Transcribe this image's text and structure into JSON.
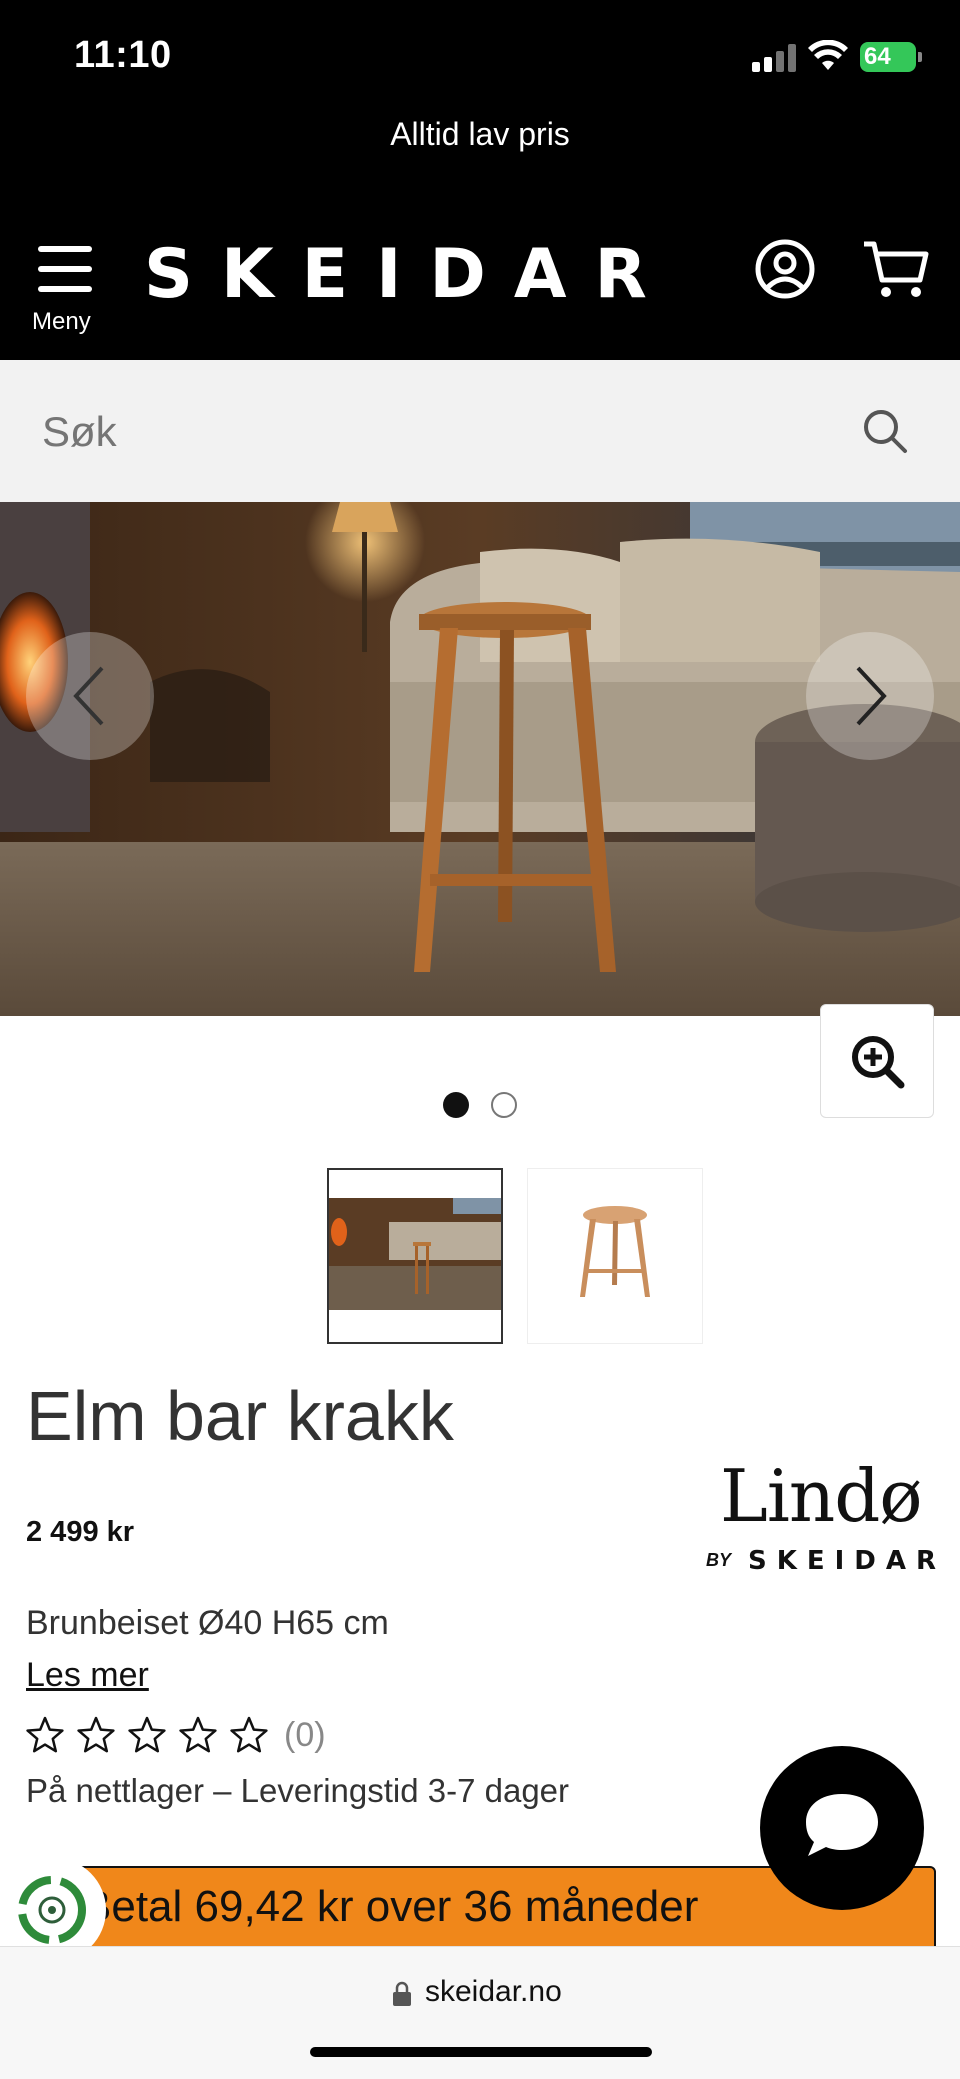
{
  "status_bar": {
    "time": "11:10",
    "battery": "64"
  },
  "promo": {
    "text": "Alltid lav pris"
  },
  "header": {
    "menu_label": "Meny",
    "logo": "SKEIDAR",
    "icons": [
      "account-icon",
      "cart-icon"
    ]
  },
  "search": {
    "placeholder": "Søk"
  },
  "gallery": {
    "image_count": 2,
    "active_index": 0
  },
  "product": {
    "title": "Elm bar krakk",
    "price": "2 499 kr",
    "brand": {
      "name": "Lindø",
      "by": "BY",
      "store": "SKEIDAR"
    },
    "variant": "Brunbeiset Ø40 H65 cm",
    "read_more": "Les mer",
    "rating": {
      "stars": 0,
      "max": 5,
      "count_label": "(0)"
    },
    "stock": "På nettlager – Leveringstid 3-7 dager"
  },
  "finance": {
    "text": "Betal 69,42 kr over 36 måneder"
  },
  "browser": {
    "url": "skeidar.no"
  },
  "colors": {
    "header_bg": "#000000",
    "finance_bg": "#f0871a",
    "search_bg": "#f2f2f2"
  }
}
